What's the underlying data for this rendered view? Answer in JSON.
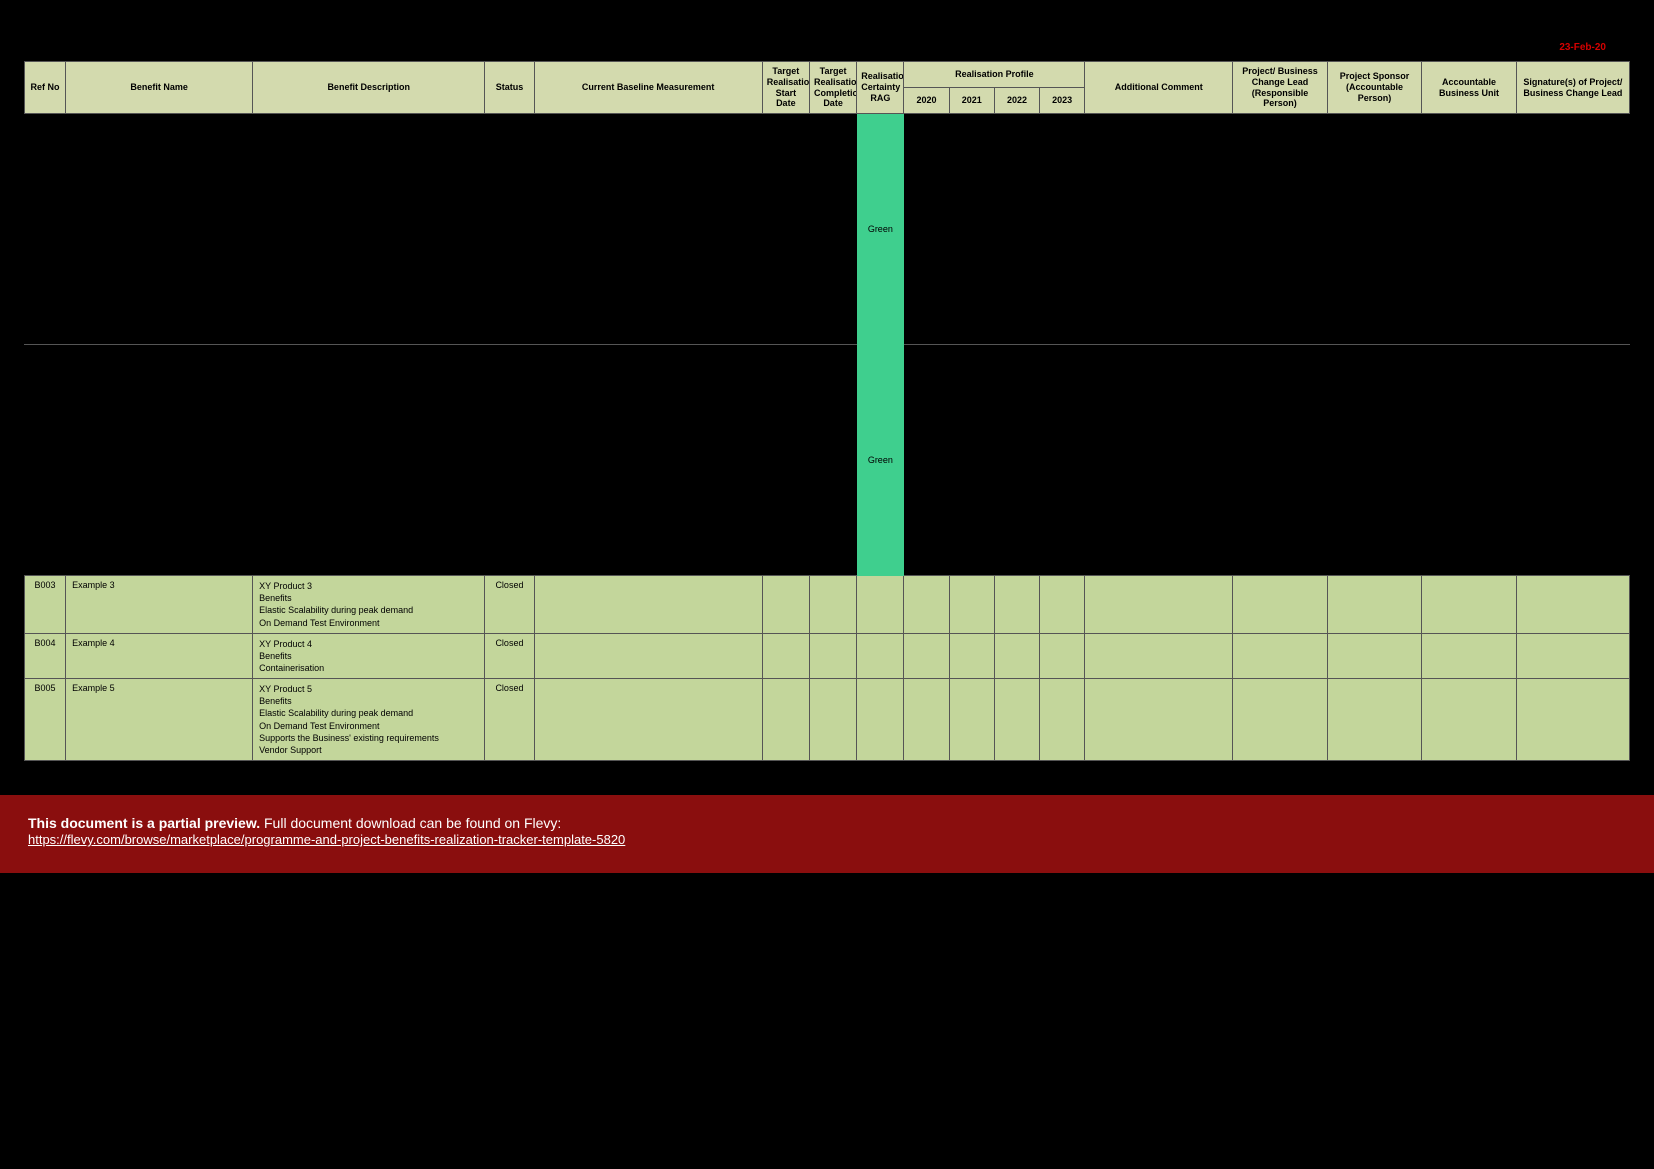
{
  "meta": {
    "date_stamp": "23-Feb-20"
  },
  "headers": {
    "ref_no": "Ref No",
    "benefit_name": "Benefit Name",
    "benefit_description": "Benefit Description",
    "status": "Status",
    "current_baseline": "Current Baseline Measurement",
    "target_start": "Target Realisation Start Date",
    "target_completion": "Target Realisation Completion Date",
    "rag": "Realisation Certainty RAG",
    "realisation_profile": "Realisation Profile",
    "years": [
      "2020",
      "2021",
      "2022",
      "2023"
    ],
    "additional_comment": "Additional Comment",
    "change_lead": "Project/ Business Change Lead (Responsible Person)",
    "project_sponsor": "Project Sponsor (Accountable Person)",
    "accountable_bu": "Accountable Business Unit",
    "signature": "Signature(s) of Project/ Business Change Lead"
  },
  "rows_dark": [
    {
      "rag": "Green"
    },
    {
      "rag": "Green"
    }
  ],
  "rows_light": [
    {
      "ref": "B003",
      "name": "Example 3",
      "desc_lines": [
        "XY Product 3",
        "Benefits",
        "Elastic Scalability during peak demand",
        "On Demand Test Environment"
      ],
      "status": "Closed"
    },
    {
      "ref": "B004",
      "name": "Example 4",
      "desc_lines": [
        "XY Product 4",
        "Benefits",
        "Containerisation"
      ],
      "status": "Closed"
    },
    {
      "ref": "B005",
      "name": "Example 5",
      "desc_lines": [
        "XY Product 5",
        "Benefits",
        "Elastic Scalability during peak demand",
        "On Demand Test Environment",
        "Supports the Business' existing requirements",
        "Vendor Support"
      ],
      "status": "Closed"
    }
  ],
  "banner": {
    "bold": "This document is a partial preview.",
    "rest": "  Full document download can be found on Flevy:",
    "link_text": "https://flevy.com/browse/marketplace/programme-and-project-benefits-realization-tracker-template-5820",
    "link_href": "https://flevy.com/browse/marketplace/programme-and-project-benefits-realization-tracker-template-5820"
  }
}
